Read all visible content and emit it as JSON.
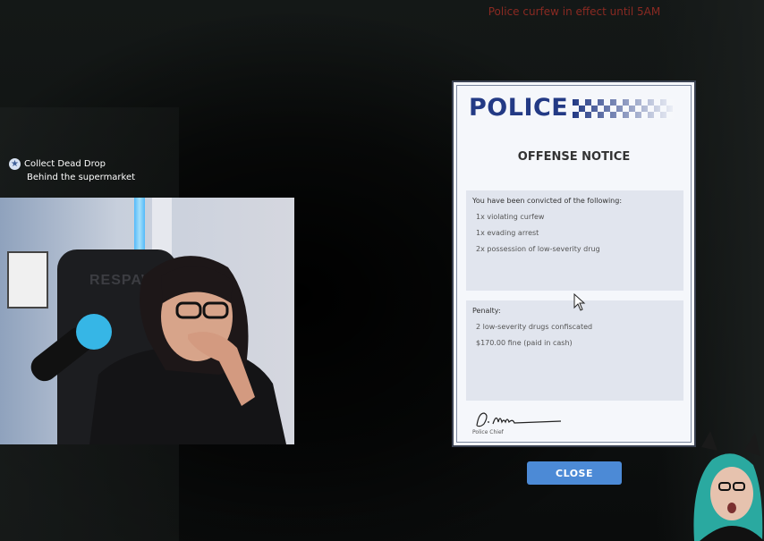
{
  "hud": {
    "curfew_text": "Police curfew in effect until 5AM",
    "objective": {
      "icon": "star-icon",
      "title": "Collect Dead Drop",
      "subtitle": "Behind the supermarket"
    }
  },
  "webcam": {
    "chair_brand": "RESPAW"
  },
  "notice": {
    "brand": "POLICE",
    "heading": "OFFENSE NOTICE",
    "convictions": {
      "title": "You have been convicted of the following:",
      "items": [
        "1x violating curfew",
        "1x evading arrest",
        "2x possession of low-severity drug"
      ]
    },
    "penalty": {
      "title": "Penalty:",
      "items": [
        "2 low-severity drugs confiscated",
        "$170.00 fine (paid in cash)"
      ]
    },
    "signature_name": "D. Murphy",
    "signature_label": "Police Chief"
  },
  "close_button": {
    "label": "CLOSE"
  },
  "colors": {
    "police_blue": "#233a85",
    "button_blue": "#4c8ad6",
    "curfew_red": "#8a2a22"
  }
}
